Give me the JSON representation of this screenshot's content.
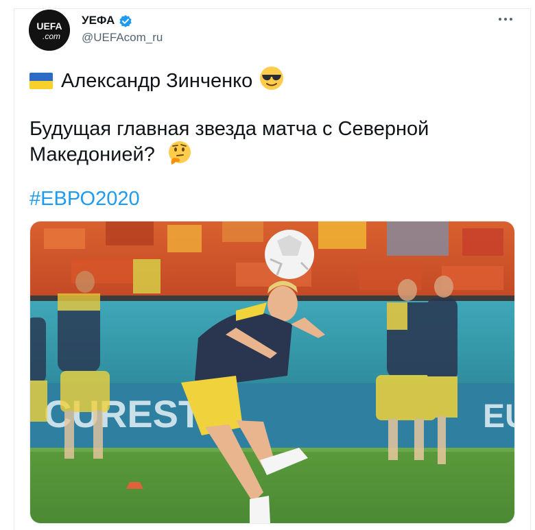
{
  "tweet": {
    "author_name": "УЕФА",
    "author_handle": "@UEFAcom_ru",
    "avatar_text_top": "UEFA",
    "avatar_text_bottom": ".com",
    "line1_text": "Александр Зинченко",
    "line2_text": "Будущая главная звезда матча с Северной Македонией?",
    "hashtag": "#ЕВРО2020",
    "banner_text": "CURESTI",
    "banner_text_right": "EUR"
  },
  "icons": {
    "flag": "ukraine-flag-icon",
    "emoji1": "sunglasses-emoji-icon",
    "emoji2": "thinking-face-emoji-icon",
    "verified": "verified-badge-icon",
    "more": "more-options-icon"
  },
  "colors": {
    "link": "#1d9bf0",
    "secondary_text": "#536471",
    "verified": "#1d9bf0"
  }
}
